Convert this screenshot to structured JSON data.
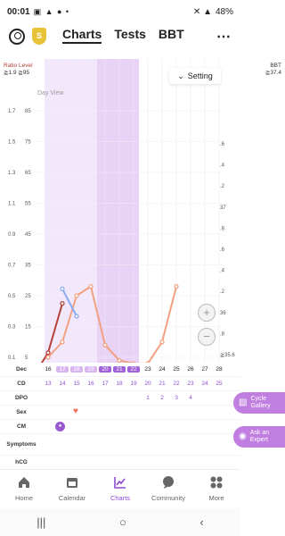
{
  "status": {
    "time": "00:01",
    "left_icons": "▣ ▲ ● •",
    "right_icons": "✕ ▲",
    "battery": "48%"
  },
  "header": {
    "tabs": [
      {
        "label": "Charts",
        "active": true
      },
      {
        "label": "Tests",
        "active": false
      },
      {
        "label": "BBT",
        "active": false
      }
    ],
    "shield_badge": "S"
  },
  "chart": {
    "legend_left": {
      "line1": "Ratio Level",
      "line2": "≧1.9  ≧95"
    },
    "legend_right": {
      "line1": "BBT",
      "line2": "≧37.4"
    },
    "day_view": "Day View",
    "setting_label": "Setting",
    "ratio_ticks": [
      "1.7",
      "1.5",
      "1.3",
      "1.1",
      "0.9",
      "0.7",
      "0.5",
      "0.3",
      "0.1"
    ],
    "level_ticks": [
      "85",
      "75",
      "65",
      "55",
      "45",
      "35",
      "25",
      "15",
      "5"
    ],
    "bbt_ticks": [
      ".6",
      ".4",
      ".2",
      "37",
      ".8",
      ".6",
      ".4",
      ".2",
      "36",
      ".8",
      "≧35.6"
    ],
    "colors": {
      "ratio": "#b5413a",
      "level": "#f2a080",
      "bbt": "#8aaaf0",
      "fertile": "#f3e8fb",
      "ovulation": "#e8d3f7"
    }
  },
  "chart_data": {
    "type": "line",
    "dates": [
      "Dec 16",
      "17",
      "18",
      "19",
      "20",
      "21",
      "22",
      "23",
      "24",
      "25",
      "26",
      "27",
      "28"
    ],
    "series": [
      {
        "name": "Ratio",
        "x": [
          13,
          14
        ],
        "y": [
          0.13,
          0.45
        ]
      },
      {
        "name": "Level",
        "x": [
          13,
          14,
          15,
          16,
          17,
          18,
          19,
          20,
          21,
          22
        ],
        "y": [
          5,
          10,
          25,
          28,
          9,
          4,
          3,
          3,
          10,
          28
        ]
      },
      {
        "name": "BBT",
        "x": [
          14,
          15
        ],
        "y": [
          36.1,
          35.9
        ]
      }
    ]
  },
  "rows": {
    "dec_label": "Dec",
    "dates": [
      "16",
      "17",
      "18",
      "19",
      "20",
      "21",
      "22",
      "23",
      "24",
      "25",
      "26",
      "27",
      "28"
    ],
    "cd_label": "CD",
    "cd": [
      "13",
      "14",
      "15",
      "16",
      "17",
      "18",
      "19",
      "20",
      "21",
      "22",
      "23",
      "24",
      "25"
    ],
    "dpo_label": "DPO",
    "dpo": [
      "",
      "",
      "",
      "",
      "",
      "",
      "",
      "1",
      "2",
      "3",
      "4",
      "",
      ""
    ],
    "sex_label": "Sex",
    "cm_label": "CM",
    "symptoms_label": "Symptoms",
    "hcg_label": "hCG"
  },
  "side_buttons": {
    "cycle_gallery": "Cycle Gallery",
    "ask_expert": "Ask an Expert"
  },
  "nav": [
    {
      "label": "Home"
    },
    {
      "label": "Calendar"
    },
    {
      "label": "Charts",
      "active": true
    },
    {
      "label": "Community"
    },
    {
      "label": "More"
    }
  ]
}
